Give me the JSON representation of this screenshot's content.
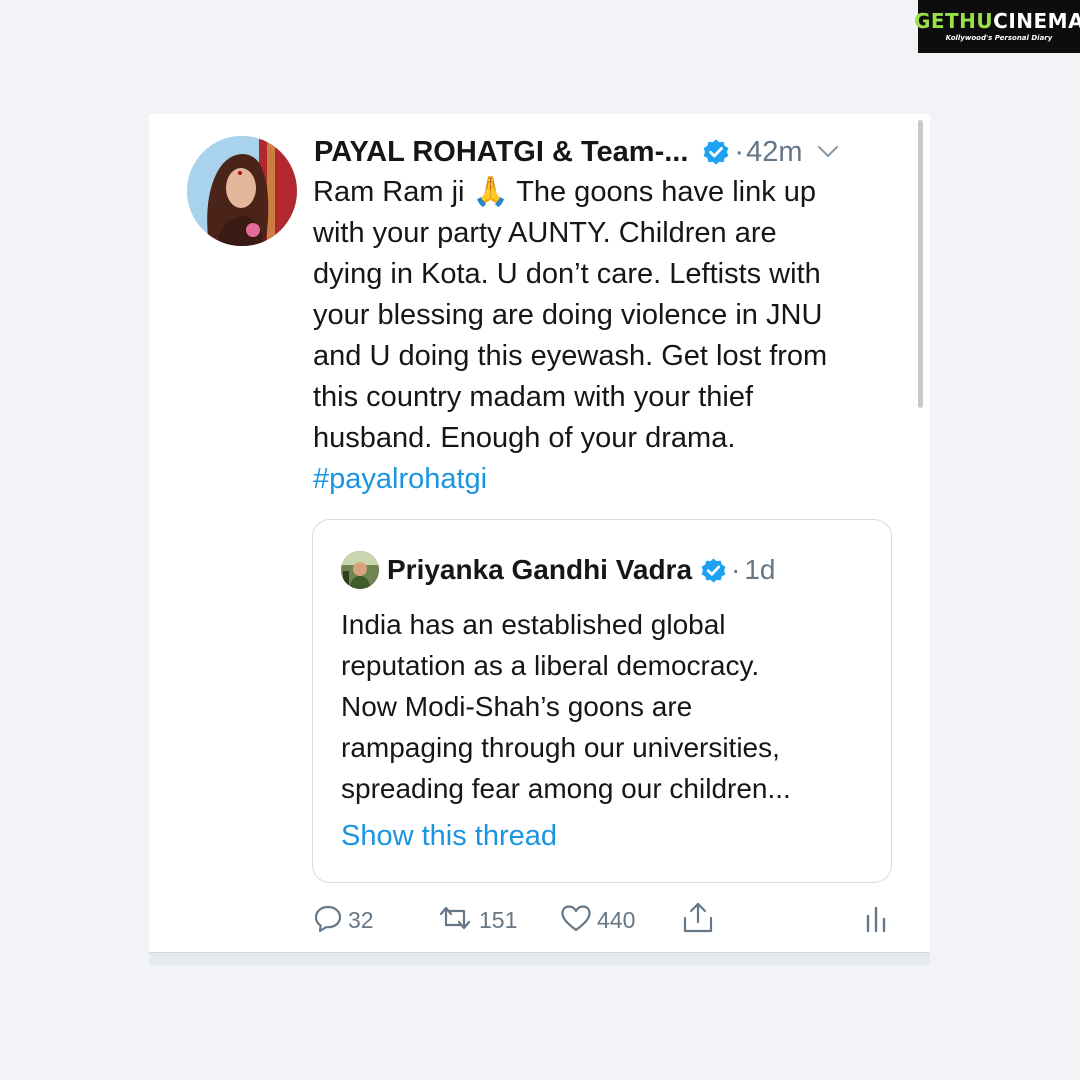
{
  "watermark": {
    "part1": "GETHU",
    "part2": "CINEMA",
    "tagline": "Kollywood's Personal Diary"
  },
  "tweet": {
    "author": "PAYAL ROHATGI & Team-...",
    "separator": "·",
    "time": "42m",
    "lines": [
      "Ram Ram ji 🙏 The goons have link up",
      "with your party AUNTY. Children are",
      "dying in Kota. U don’t care. Leftists with",
      "your blessing are doing violence in JNU",
      "and U doing this eyewash. Get lost from",
      "this country madam with your thief",
      "husband. Enough of your drama."
    ],
    "hashtag": "#payalrohatgi"
  },
  "quoted": {
    "author": "Priyanka Gandhi Vadra",
    "separator": "·",
    "time": "1d",
    "lines": [
      "India has an established global",
      "reputation as a liberal democracy.",
      "Now Modi-Shah’s goons are",
      "rampaging through our universities,",
      "spreading fear among our children..."
    ],
    "show_thread": "Show this thread"
  },
  "actions": {
    "reply_count": "32",
    "retweet_count": "151",
    "like_count": "440"
  },
  "colors": {
    "link": "#1b95e0",
    "secondary": "#657786",
    "verified": "#1da1f2",
    "text": "#14171a"
  }
}
